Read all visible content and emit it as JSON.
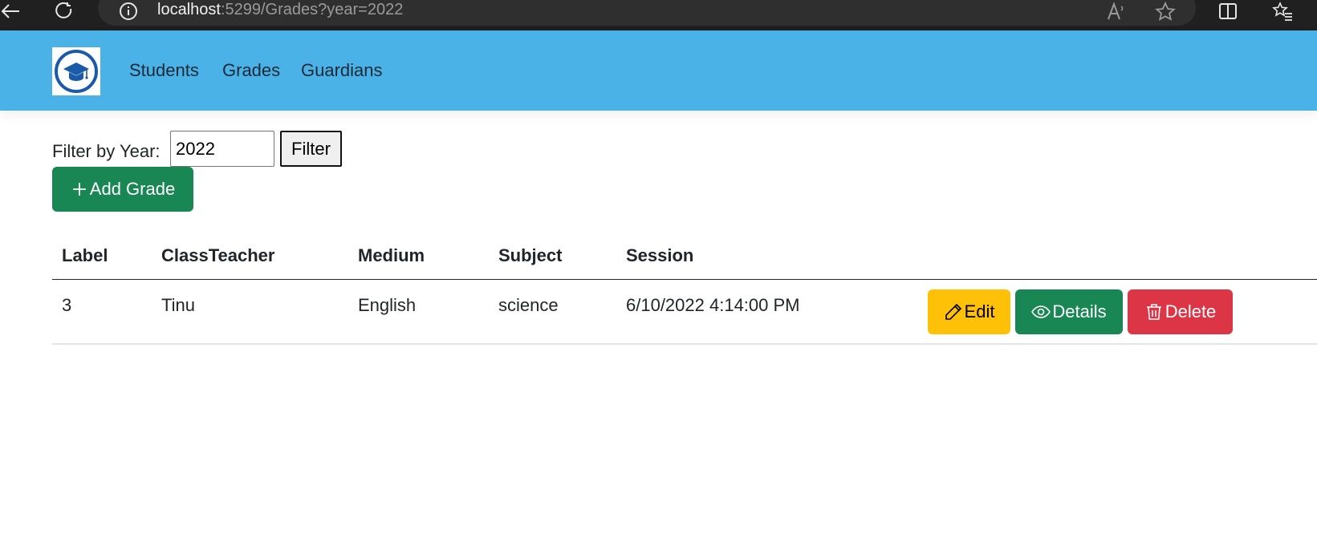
{
  "browser": {
    "url_host": "localhost",
    "url_rest": ":5299/Grades?year=2022"
  },
  "navbar": {
    "links": [
      "Students",
      "Grades",
      "Guardians"
    ]
  },
  "filter": {
    "label": "Filter by Year:",
    "year_value": "2022",
    "button_label": "Filter"
  },
  "add_button_label": "Add Grade",
  "table": {
    "headers": [
      "Label",
      "ClassTeacher",
      "Medium",
      "Subject",
      "Session"
    ],
    "rows": [
      [
        "3",
        "Tinu",
        "English",
        "science",
        "6/10/2022 4:14:00 PM"
      ]
    ],
    "actions": {
      "edit": "Edit",
      "details": "Details",
      "delete": "Delete"
    }
  },
  "colors": {
    "navbar": "#4ab2e6",
    "success": "#198754",
    "warning": "#ffc107",
    "danger": "#dc3545"
  }
}
